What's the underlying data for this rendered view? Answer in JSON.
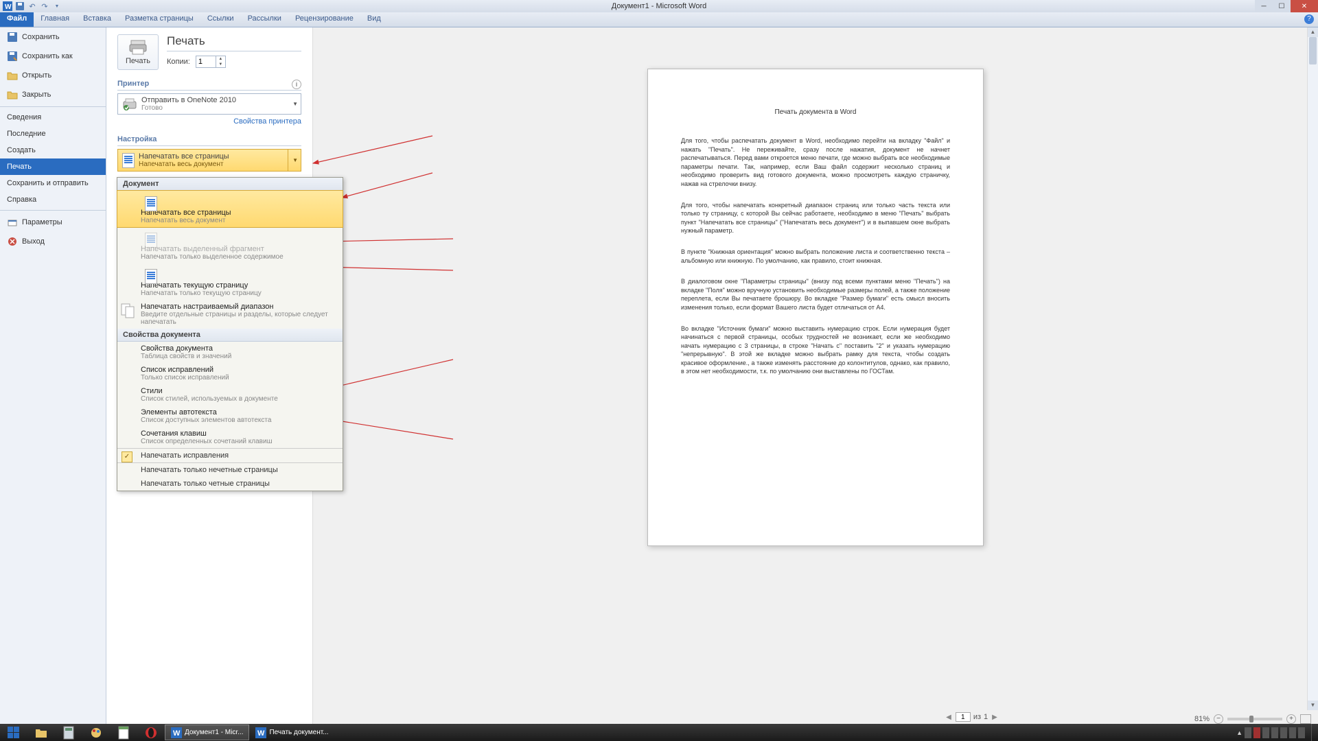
{
  "window": {
    "title": "Документ1 - Microsoft Word"
  },
  "tabs": {
    "file": "Файл",
    "home": "Главная",
    "insert": "Вставка",
    "layout": "Разметка страницы",
    "refs": "Ссылки",
    "mail": "Рассылки",
    "review": "Рецензирование",
    "view": "Вид"
  },
  "sidebar": {
    "save": "Сохранить",
    "saveas": "Сохранить как",
    "open": "Открыть",
    "close": "Закрыть",
    "info": "Сведения",
    "recent": "Последние",
    "new": "Создать",
    "print": "Печать",
    "share": "Сохранить и отправить",
    "help": "Справка",
    "options": "Параметры",
    "exit": "Выход"
  },
  "print": {
    "heading": "Печать",
    "button": "Печать",
    "copies_label": "Копии:",
    "copies_value": "1",
    "printer_heading": "Принтер",
    "printer_name": "Отправить в OneNote 2010",
    "printer_status": "Готово",
    "printer_props": "Свойства принтера",
    "settings_heading": "Настройка",
    "combo_title": "Напечатать все страницы",
    "combo_sub": "Напечатать весь документ"
  },
  "dropdown": {
    "sec_doc": "Документ",
    "i1_t": "Напечатать все страницы",
    "i1_s": "Напечатать весь документ",
    "i2_t": "Напечатать выделенный фрагмент",
    "i2_s": "Напечатать только выделенное содержимое",
    "i3_t": "Напечатать текущую страницу",
    "i3_s": "Напечатать только текущую страницу",
    "i4_t": "Напечатать настраиваемый диапазон",
    "i4_s": "Введите отдельные страницы и разделы, которые следует напечатать",
    "sec_props": "Свойства документа",
    "p1_t": "Свойства документа",
    "p1_s": "Таблица свойств и значений",
    "p2_t": "Список исправлений",
    "p2_s": "Только список исправлений",
    "p3_t": "Стили",
    "p3_s": "Список стилей, используемых в документе",
    "p4_t": "Элементы автотекста",
    "p4_s": "Список доступных элементов автотекста",
    "p5_t": "Сочетания клавиш",
    "p5_s": "Список определенных сочетаний клавиш",
    "chk": "Напечатать исправления",
    "odd": "Напечатать только нечетные страницы",
    "even": "Напечатать только четные страницы"
  },
  "nav": {
    "page_value": "1",
    "of_label": "из",
    "total": "1"
  },
  "status": {
    "zoom": "81%"
  },
  "preview": {
    "title": "Печать документа в Word",
    "p1": "Для того, чтобы распечатать документ в Word, необходимо перейти на вкладку \"Файл\" и нажать \"Печать\". Не переживайте, сразу после нажатия, документ не начнет распечатываться. Перед вами откроется меню печати, где можно выбрать все необходимые параметры печати. Так, например, если Ваш файл содержит несколько страниц и необходимо проверить вид готового документа, можно просмотреть каждую страничку, нажав на стрелочки внизу.",
    "p2": "Для того, чтобы напечатать конкретный диапазон страниц или только часть текста или только ту страницу, с которой Вы сейчас работаете, необходимо в меню \"Печать\" выбрать пункт \"Напечатать все страницы\" (\"Напечатать весь документ\") и в выпавшем окне выбрать нужный параметр.",
    "p3": "В пункте \"Книжная ориентация\" можно выбрать положение листа и соответственно текста – альбомную или книжную. По умолчанию, как правило, стоит книжная.",
    "p4": "В диалоговом окне \"Параметры страницы\" (внизу под всеми пунктами меню \"Печать\") на вкладке \"Поля\" можно вручную установить необходимые размеры полей, а также положение переплета, если Вы печатаете брошюру. Во вкладке \"Размер бумаги\" есть смысл вносить изменения только, если формат Вашего листа будет отличаться от А4.",
    "p5": "Во вкладке \"Источник бумаги\" можно выставить нумерацию строк. Если нумерация будет начинаться с первой страницы, особых трудностей не возникает, если же необходимо начать нумерацию с 3 страницы, в строке \"Начать с\" поставить \"2\" и указать нумерацию \"непрерывную\". В этой же вкладке можно выбрать рамку для текста, чтобы создать красивое оформление., а также изменять расстояние до колонтитулов, однако, как правило, в этом нет необходимости, т.к. по умолчанию они выставлены по ГОСТам."
  },
  "taskbar": {
    "app1": "Документ1 - Micr...",
    "app2": "Печать документ..."
  }
}
